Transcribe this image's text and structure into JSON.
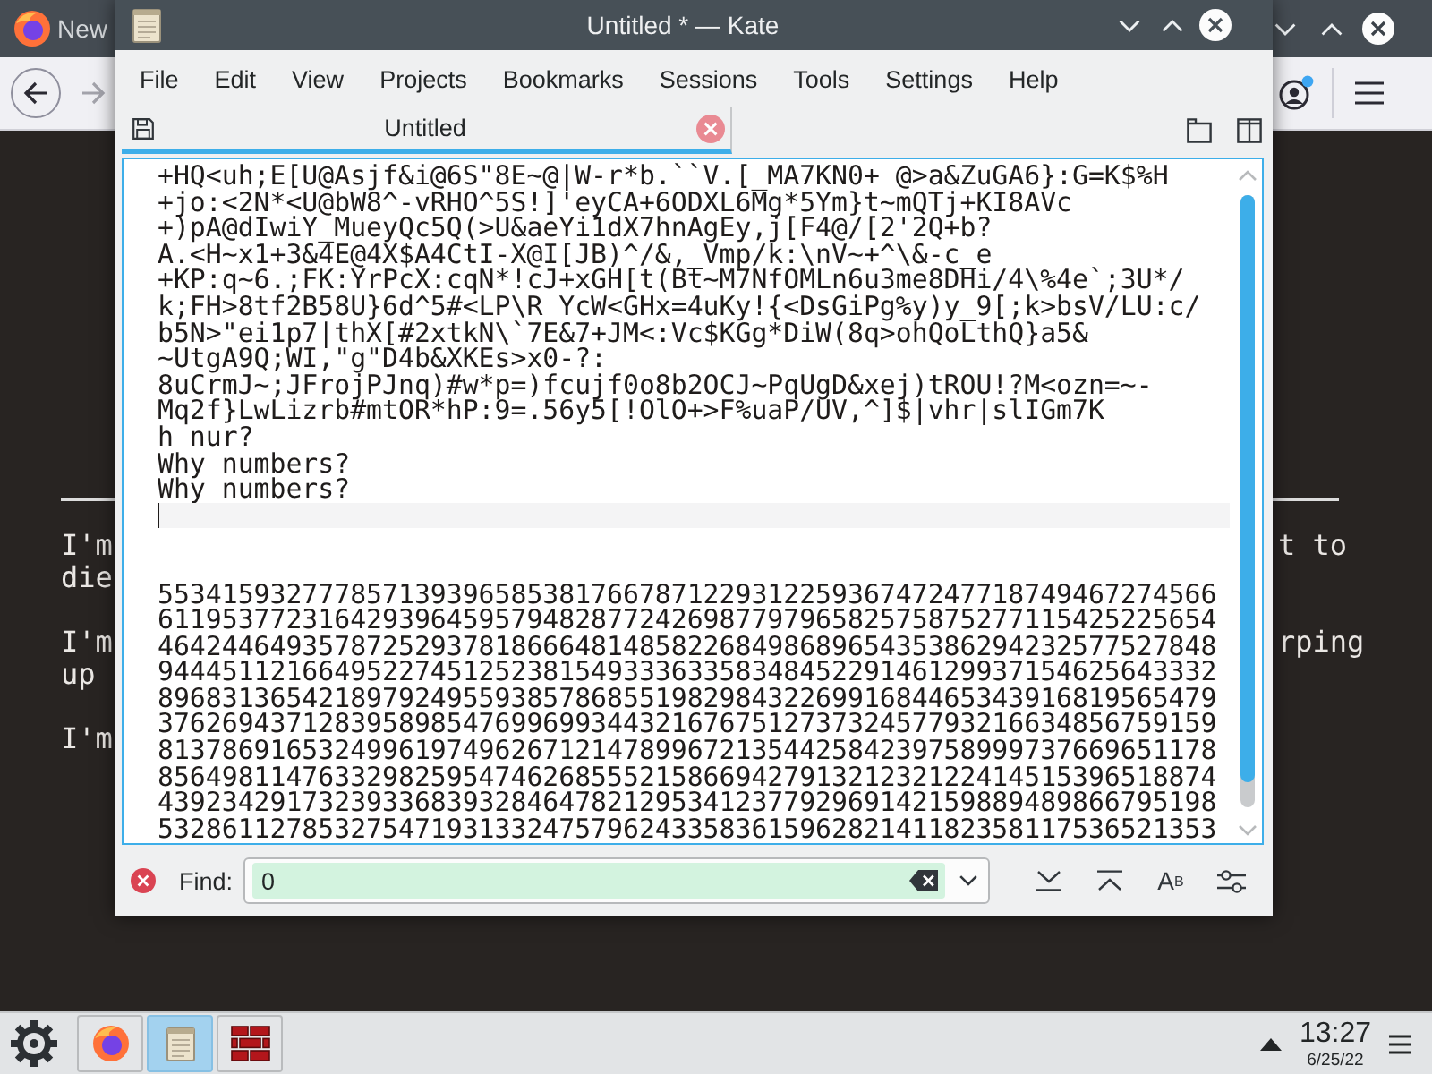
{
  "browser_window": {
    "tab_title": "New",
    "page": {
      "paragraphs": [
        {
          "left_lines": [
            "I'm",
            "die"
          ],
          "right_lines": [
            "t to"
          ]
        },
        {
          "left_lines": [
            "I'm",
            "up"
          ],
          "right_lines": [
            "rping"
          ]
        },
        {
          "left_lines": [
            "I'm"
          ]
        }
      ]
    }
  },
  "editor_window": {
    "title": "Untitled * — Kate",
    "menu": [
      "File",
      "Edit",
      "View",
      "Projects",
      "Bookmarks",
      "Sessions",
      "Tools",
      "Settings",
      "Help"
    ],
    "tabs": [
      {
        "label": "Untitled",
        "selected": true,
        "modified": true
      }
    ],
    "lines": [
      {
        "text": "+HQ<uh;E[U@Asjf&i@6S\"8E~@|W-r*b.``V.[_MA7KN0+ @>a&ZuGA6}:G=K$%H",
        "current": false
      },
      {
        "text": "+jo:<2N*<U@bW8^-vRHO^5S!]'eyCA+6ODXL6Mg*5Ym}t~mQTj+KI8AVc",
        "current": false
      },
      {
        "text": "+)pA@dIwiY_MueyQc5Q(>U&aeYi1dX7hnAgEy,j[F4@/[2'2Q+b?",
        "current": false
      },
      {
        "text": "A.<H~x1+3&4E@4X$A4CtI-X@I[JB)^/&,_Vmp/k:\\nV~+^\\&-c_e",
        "current": false
      },
      {
        "text": "+KP:q~6.;FK:YrPcX:cqN*!cJ+xGH[t(Bt~M7NfOMLn6u3me8DHi/4\\%4e`;3U*/",
        "current": false
      },
      {
        "text": "k;FH>8tf2B58U}6d^5#<LP\\R YcW<GHx=4uKy!{<DsGiPg%y)y_9[;k>bsV/LU:c/",
        "current": false
      },
      {
        "text": "b5N>\"ei1p7|thX[#2xtkN\\`7E&7+JM<:Vc$KGg*DiW(8q>ohQoLthQ}a5&",
        "current": false
      },
      {
        "text": "~UtgA9Q;WI,\"g\"D4b&XKEs>x0-?:",
        "current": false
      },
      {
        "text": "8uCrmJ~;JFrojPJnq)#w*p=)fcujf0o8b2OCJ~PqUgD&xej)tROU!?M<ozn=~-",
        "current": false
      },
      {
        "text": "Mq2f}LwLizrb#mtOR*hP:9=.56y5[!OlO+>F%uaP/UV,^]$|vhr|slIGm7K",
        "current": false
      },
      {
        "text": "h nur?",
        "current": false
      },
      {
        "text": "Why numbers?",
        "current": false
      },
      {
        "text": "Why numbers?",
        "current": false
      },
      {
        "current": true
      },
      {
        "current": false
      },
      {
        "current": false
      },
      {
        "text": "553415932777857139396585381766787122931225936747247718749467274566",
        "current": false
      },
      {
        "text": "611953772316429396459579482877242698779796582575875277115425225654",
        "current": false
      },
      {
        "text": "464244649357872529378186664814858226849868965435386294232577527848",
        "current": false
      },
      {
        "text": "944451121664952274512523815493336335834845229146129937154625643332",
        "current": false
      },
      {
        "text": "896831365421897924955938578685519829843226991684465343916819565479",
        "current": false
      },
      {
        "text": "376269437128395898547699699344321676751273732457793216634856759159",
        "current": false
      },
      {
        "text": "813786916532499619749626712147899672135442584239758999737669651178",
        "current": false
      },
      {
        "text": "856498114763329825954746268555215866942791321232122414515396518874",
        "current": false
      },
      {
        "text": "439234291732393368393284647821295341237792969142159889489866795198",
        "current": false
      },
      {
        "text": "532861127853275471931332475796243358361596282141182358117536521353",
        "current": false
      }
    ],
    "find_bar": {
      "label": "Find:",
      "value": "0",
      "found": true,
      "case_label": "A$^{B}$"
    }
  },
  "taskbar": {
    "tasks": [
      {
        "selected": false
      },
      {
        "selected": true
      },
      {
        "selected": false
      }
    ],
    "clock": {
      "time": "13:27",
      "date": "6/25/22"
    }
  }
}
